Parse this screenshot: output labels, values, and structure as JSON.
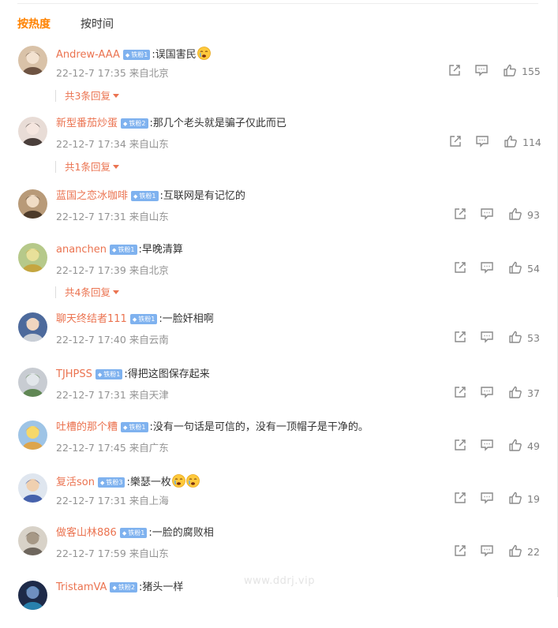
{
  "tabs": {
    "hot": "按热度",
    "time": "按时间"
  },
  "colors": {
    "accent": "#ff8200",
    "username": "#eb7350",
    "badge": "#7fb2ef",
    "meta": "#939393"
  },
  "comments": [
    {
      "user": "Andrew-AAA",
      "badge": "铁粉1",
      "text": ":误国害民",
      "emojis": 1,
      "time": "22-12-7 17:35 来自北京",
      "likes": "155",
      "replies": "共3条回复"
    },
    {
      "user": "新型番茄炒蛋",
      "badge": "铁粉2",
      "text": ":那几个老头就是骗子仅此而已",
      "emojis": 0,
      "time": "22-12-7 17:34 来自山东",
      "likes": "114",
      "replies": "共1条回复"
    },
    {
      "user": "蓝国之恋冰咖啡",
      "badge": "铁粉1",
      "text": ":互联网是有记忆的",
      "emojis": 0,
      "time": "22-12-7 17:31 来自山东",
      "likes": "93",
      "replies": ""
    },
    {
      "user": "ananchen",
      "badge": "铁粉1",
      "text": ":早晚清算",
      "emojis": 0,
      "time": "22-12-7 17:39 来自北京",
      "likes": "54",
      "replies": "共4条回复"
    },
    {
      "user": "聊天终结者111",
      "badge": "铁粉1",
      "text": ":一脸奸相啊",
      "emojis": 0,
      "time": "22-12-7 17:40 来自云南",
      "likes": "53",
      "replies": ""
    },
    {
      "user": "TJHPSS",
      "badge": "铁粉1",
      "text": ":得把这图保存起来",
      "emojis": 0,
      "time": "22-12-7 17:31 来自天津",
      "likes": "37",
      "replies": ""
    },
    {
      "user": "吐槽的那个糟",
      "badge": "铁粉1",
      "text": ":没有一句话是可信的，没有一顶帽子是干净的。",
      "emojis": 0,
      "time": "22-12-7 17:45 来自广东",
      "likes": "49",
      "replies": ""
    },
    {
      "user": "复活son",
      "badge": "铁粉3",
      "text": ":樂瑟一枚",
      "emojis": 2,
      "time": "22-12-7 17:31 来自上海",
      "likes": "19",
      "replies": ""
    },
    {
      "user": "做客山林886",
      "badge": "铁粉1",
      "text": ":一脸的腐败相",
      "emojis": 0,
      "time": "22-12-7 17:59 来自山东",
      "likes": "22",
      "replies": ""
    },
    {
      "user": "TristamVA",
      "badge": "铁粉2",
      "text": ":猪头一样",
      "emojis": 0,
      "time": "",
      "likes": "",
      "replies": ""
    }
  ],
  "watermark": "www.ddrj.vip"
}
